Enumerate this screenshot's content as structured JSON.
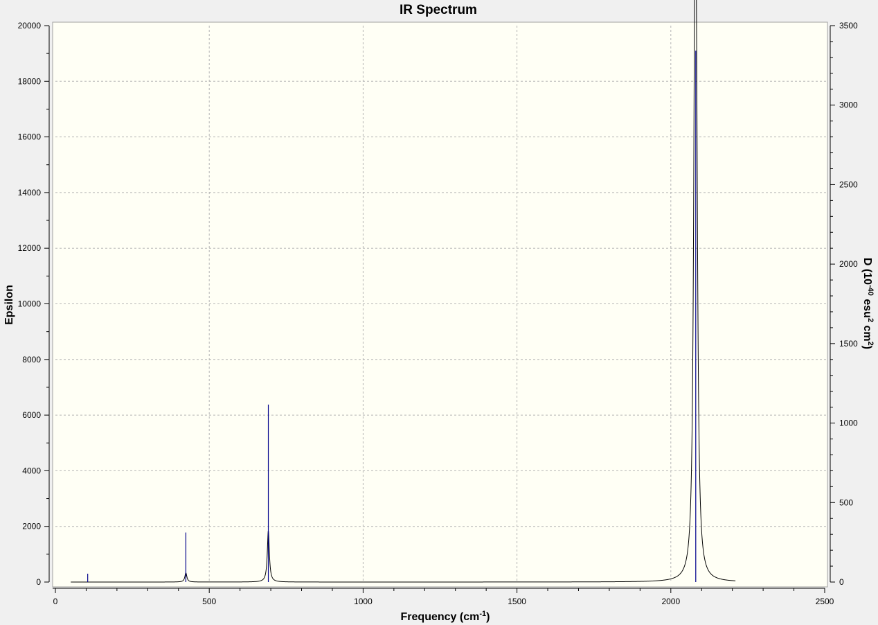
{
  "chart_data": {
    "type": "line",
    "title": "IR Spectrum",
    "xlabel": "Frequency (cm-1)",
    "ylabel_left": "Epsilon",
    "ylabel_right": "D (10-40 esu2 cm2)",
    "xlim": [
      0,
      2500
    ],
    "ylim_left": [
      0,
      20000
    ],
    "ylim_right": [
      0,
      3500
    ],
    "x_ticks": [
      "0",
      "500",
      "1000",
      "1500",
      "2000",
      "2500"
    ],
    "y_left_ticks": [
      "0",
      "2000",
      "4000",
      "6000",
      "8000",
      "10000",
      "12000",
      "14000",
      "16000",
      "18000",
      "20000"
    ],
    "y_right_ticks": [
      "0",
      "500",
      "1000",
      "1500",
      "2000",
      "2500",
      "3000",
      "3500"
    ],
    "grid": true,
    "stick_color": "#00008b",
    "curve_color": "#000000",
    "plot_background": "#fffff5",
    "sticks": [
      {
        "frequency": 105,
        "intensity": 300
      },
      {
        "frequency": 424,
        "intensity": 1780
      },
      {
        "frequency": 692,
        "intensity": 6380
      },
      {
        "frequency": 2081,
        "intensity": 19100
      }
    ],
    "curve_range": [
      50,
      2210
    ],
    "curve_peaks": [
      {
        "frequency": 424,
        "height": 330,
        "hwhm": 4
      },
      {
        "frequency": 692,
        "height": 1850,
        "hwhm": 4
      },
      {
        "frequency": 2078,
        "height": 16600,
        "hwhm": 5
      },
      {
        "frequency": 2083,
        "height": 13000,
        "hwhm": 5
      }
    ]
  }
}
